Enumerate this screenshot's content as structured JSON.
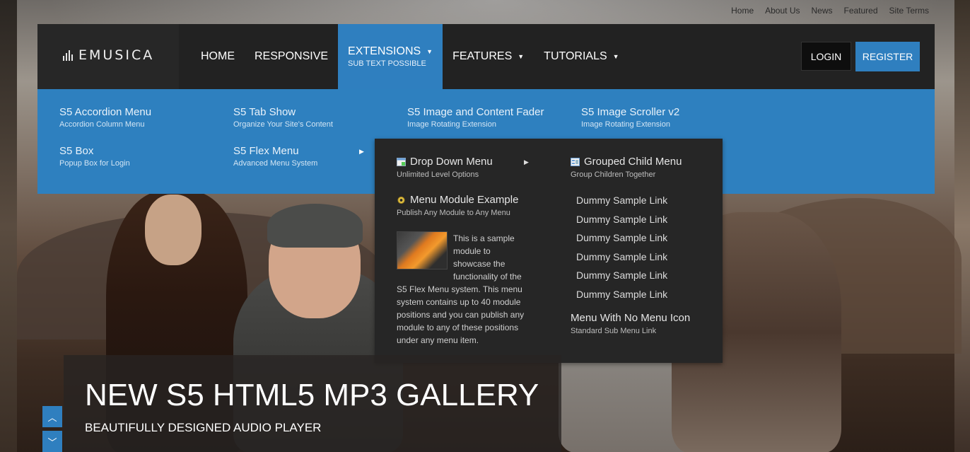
{
  "top_links": [
    "Home",
    "About Us",
    "News",
    "Featured",
    "Site Terms"
  ],
  "logo": {
    "text": "EMUSICA"
  },
  "nav": {
    "items": [
      {
        "label": "HOME",
        "sub": "",
        "caret": false
      },
      {
        "label": "RESPONSIVE",
        "sub": "",
        "caret": false
      },
      {
        "label": "EXTENSIONS",
        "sub": "SUB TEXT POSSIBLE",
        "caret": true
      },
      {
        "label": "FEATURES",
        "sub": "",
        "caret": true
      },
      {
        "label": "TUTORIALS",
        "sub": "",
        "caret": true
      }
    ],
    "login_label": "LOGIN",
    "register_label": "REGISTER"
  },
  "dropdown": {
    "items": [
      {
        "title": "S5 Accordion Menu",
        "sub": "Accordion Column Menu"
      },
      {
        "title": "S5 Tab Show",
        "sub": "Organize Your Site's Content"
      },
      {
        "title": "S5 Image and Content Fader",
        "sub": "Image Rotating Extension"
      },
      {
        "title": "S5 Image Scroller v2",
        "sub": "Image Rotating Extension"
      },
      {
        "title": "S5 Box",
        "sub": "Popup Box for Login"
      },
      {
        "title": "S5 Flex Menu",
        "sub": "Advanced Menu System"
      }
    ]
  },
  "flyout": {
    "drop_down": {
      "title": "Drop Down Menu",
      "sub": "Unlimited Level Options"
    },
    "module_example": {
      "title": "Menu Module Example",
      "sub": "Publish Any Module to Any Menu"
    },
    "paragraph_lines": [
      "This is a sample",
      "module to",
      "showcase the",
      "functionality of the",
      "S5 Flex Menu system. This menu",
      "system contains up to 40 module",
      "positions and you can publish any",
      "module to any of these positions",
      "under any menu item."
    ],
    "grouped": {
      "title": "Grouped Child Menu",
      "sub": "Group Children Together"
    },
    "dummy_links": [
      "Dummy Sample Link",
      "Dummy Sample Link",
      "Dummy Sample Link",
      "Dummy Sample Link",
      "Dummy Sample Link",
      "Dummy Sample Link"
    ],
    "no_icon": {
      "title": "Menu With No Menu Icon",
      "sub": "Standard Sub Menu Link"
    }
  },
  "slide": {
    "title": "NEW S5 HTML5 MP3 GALLERY",
    "subtitle": "BEAUTIFULLY DESIGNED AUDIO PLAYER"
  },
  "colors": {
    "accent": "#2f7fbf",
    "navbar": "#222222",
    "flyout": "#262626"
  }
}
